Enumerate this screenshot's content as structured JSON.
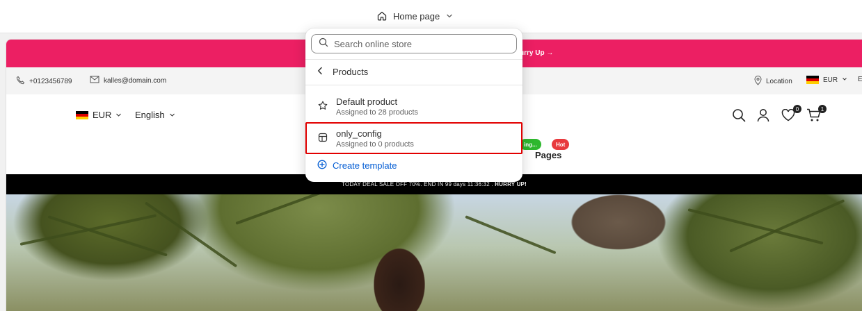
{
  "topbar": {
    "page_label": "Home page"
  },
  "store": {
    "announcement": "urry Up →",
    "phone": "+0123456789",
    "email": "kalles@domain.com",
    "location": "Location",
    "currency_top": "EUR",
    "lang_top_partial": "E",
    "currency": "EUR",
    "language": "English",
    "badge_sale": "ing...",
    "badge_hot": "Hot",
    "nav_pages": "Pages",
    "wishlist_count": "0",
    "cart_count": "1",
    "deal_text": "TODAY DEAL SALE OFF 70%. END IN 99 days 11:36:32 .",
    "deal_cta": "HURRY UP!"
  },
  "popover": {
    "search_placeholder": "Search online store",
    "back_label": "Products",
    "templates": [
      {
        "name": "Default product",
        "assigned": "Assigned to 28 products"
      },
      {
        "name": "only_config",
        "assigned": "Assigned to 0 products"
      }
    ],
    "create_label": "Create template"
  },
  "colors": {
    "announce_bg": "#ec1f63",
    "link": "#005bd3",
    "highlight": "#e20000",
    "badge_green": "#2eb82e",
    "badge_red": "#e8393d"
  }
}
